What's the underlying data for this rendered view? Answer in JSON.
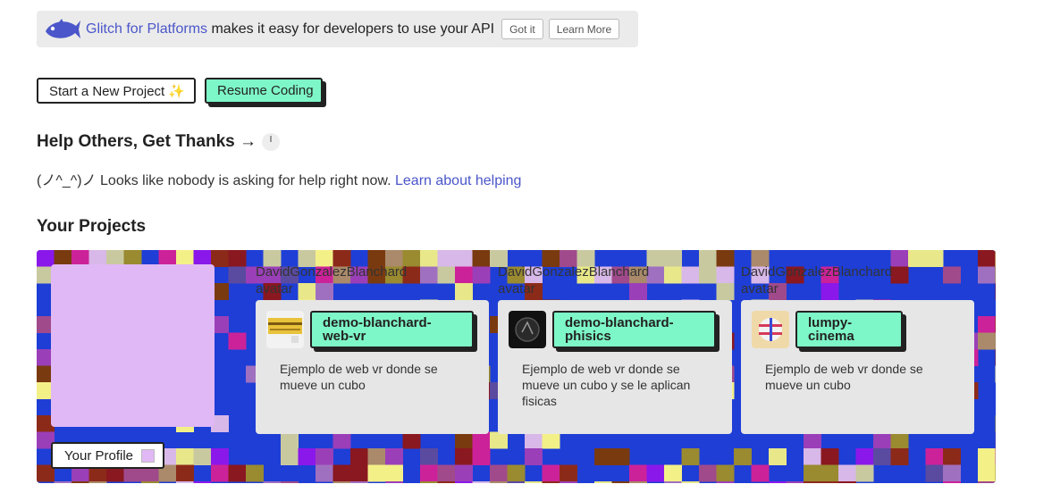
{
  "banner": {
    "link_text": "Glitch for Platforms",
    "message": " makes it easy for developers to use your API",
    "got_it": "Got it",
    "learn_more": "Learn More"
  },
  "actions": {
    "new_project": "Start a New Project ✨",
    "resume": "Resume Coding"
  },
  "help": {
    "title": "Help Others, Get Thanks →",
    "text": "(ノ^_^)ノ Looks like nobody is asking for help right now. ",
    "link": "Learn about helping"
  },
  "projects": {
    "title": "Your Projects",
    "profile_button": "Your Profile",
    "cards": [
      {
        "owner": "DavidGonzalezBlanchard",
        "owner_alt": "avatar",
        "name": "demo-blanchard-web-vr",
        "description": "Ejemplo de web vr donde se mueve un cubo"
      },
      {
        "owner": "DavidGonzalezBlanchard",
        "owner_alt": "avatar",
        "name": "demo-blanchard-phisics",
        "description": "Ejemplo de web vr donde se mueve un cubo y se le aplican fisicas"
      },
      {
        "owner": "DavidGonzalezBlanchard",
        "owner_alt": "avatar",
        "name": "lumpy-cinema",
        "description": "Ejemplo de web vr donde se mueve un cubo"
      }
    ]
  },
  "colors": {
    "accent_link": "#4a56c9",
    "button_green": "#7ef7c8",
    "projects_bg": "#1e3ed6",
    "profile_lavender": "#e0b8f5"
  }
}
